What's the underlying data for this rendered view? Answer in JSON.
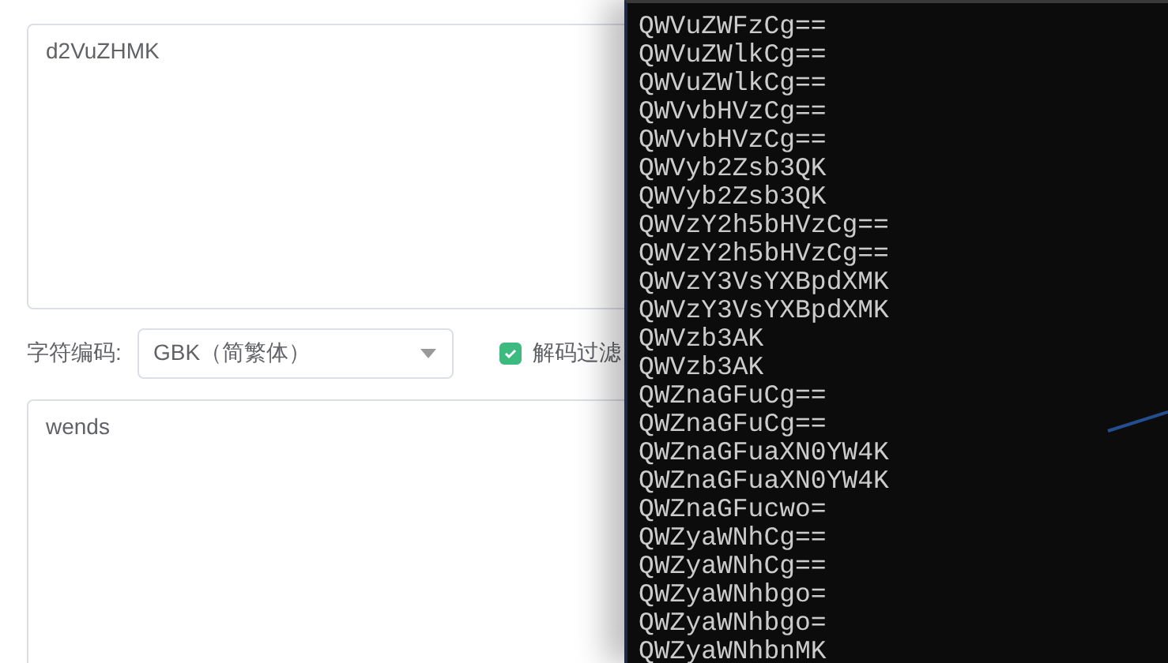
{
  "input_box": {
    "value": "d2VuZHMK"
  },
  "encoding": {
    "label": "字符编码:",
    "value": "GBK（简繁体）"
  },
  "filter_option": {
    "label": "解码过滤",
    "checked": true
  },
  "output_box": {
    "value": "wends"
  },
  "terminal": {
    "lines": [
      "QWVuZWFzCg==",
      "QWVuZWlkCg==",
      "QWVuZWlkCg==",
      "QWVvbHVzCg==",
      "QWVvbHVzCg==",
      "QWVyb2Zsb3QK",
      "QWVyb2Zsb3QK",
      "QWVzY2h5bHVzCg==",
      "QWVzY2h5bHVzCg==",
      "QWVzY3VsYXBpdXMK",
      "QWVzY3VsYXBpdXMK",
      "QWVzb3AK",
      "QWVzb3AK",
      "QWZnaGFuCg==",
      "QWZnaGFuCg==",
      "QWZnaGFuaXN0YW4K",
      "QWZnaGFuaXN0YW4K",
      "QWZnaGFucwo=",
      "QWZyaWNhCg==",
      "QWZyaWNhCg==",
      "QWZyaWNhbgo=",
      "QWZyaWNhbgo=",
      "QWZyaWNhbnMK"
    ]
  }
}
